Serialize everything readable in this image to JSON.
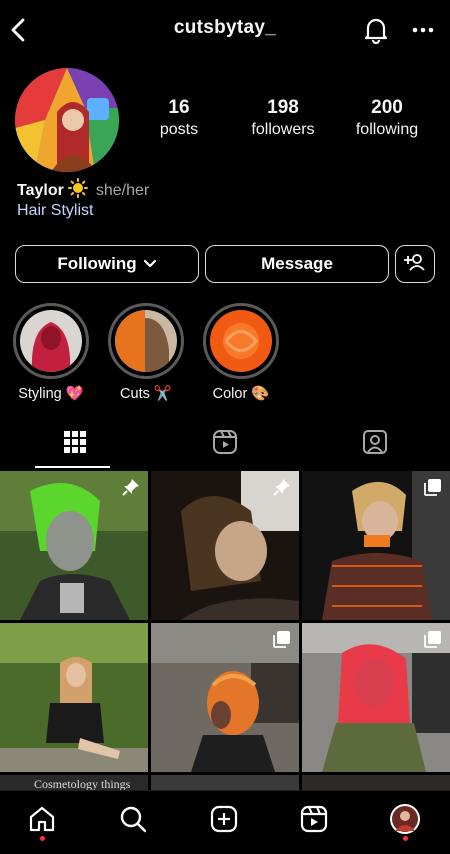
{
  "header": {
    "username": "cutsbytay_"
  },
  "profile": {
    "stats": [
      {
        "num": "16",
        "label": "posts"
      },
      {
        "num": "198",
        "label": "followers"
      },
      {
        "num": "200",
        "label": "following"
      }
    ],
    "name": "Taylor",
    "name_emoji": "sun",
    "pronouns": "she/her",
    "category": "Hair Stylist"
  },
  "actions": {
    "following_label": "Following",
    "message_label": "Message"
  },
  "highlights": [
    {
      "label": "Styling",
      "emoji": "💖"
    },
    {
      "label": "Cuts",
      "emoji": "✂️"
    },
    {
      "label": "Color",
      "emoji": "🎨"
    }
  ],
  "grid": {
    "partial_caption": "Cosmetology things"
  },
  "colors": {
    "background": "#000000",
    "text": "#f5f5f5",
    "secondary_text": "#a8a8a8",
    "link_text": "#c4d4ff",
    "notification_dot": "#ff3040"
  },
  "icons": [
    "back-chevron-icon",
    "bell-icon",
    "more-icon",
    "add-person-icon",
    "grid-icon",
    "reels-icon",
    "tagged-icon",
    "pin-icon",
    "carousel-icon",
    "home-icon",
    "search-icon",
    "create-icon",
    "reels-nav-icon"
  ]
}
